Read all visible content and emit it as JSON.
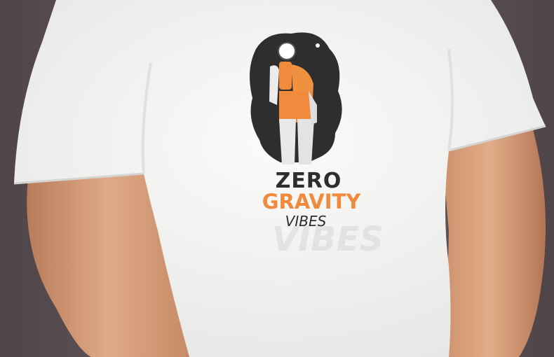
{
  "image": {
    "subject": "t-shirt mockup",
    "print": {
      "line1": "ZERO",
      "line2": "GRAVITY",
      "line3": "VIBES",
      "ghost_text": "VIBES"
    },
    "colors": {
      "background": "#5e5357",
      "shirt": "#f4f4f2",
      "skin": "#d9a47f",
      "ink_dark": "#2e2e2e",
      "ink_orange": "#f08a3c"
    }
  }
}
